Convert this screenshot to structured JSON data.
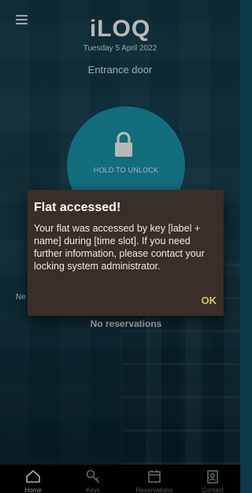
{
  "header": {
    "logo": "iLOQ",
    "date": "Tuesday 5 April 2022",
    "door_name": "Entrance door"
  },
  "unlock": {
    "label": "HOLD TO UNLOCK"
  },
  "reservations": {
    "next_label_fragment": "Ne",
    "empty_text": "No reservations"
  },
  "dialog": {
    "title": "Flat accessed!",
    "body": "Your flat was accessed by key [label + name] during [time slot]. If you need further information, please contact your locking system administrator.",
    "ok_label": "OK"
  },
  "bottom_nav": {
    "items": [
      {
        "label": "Home",
        "icon": "home-icon",
        "active": true
      },
      {
        "label": "Keys",
        "icon": "key-icon",
        "active": false
      },
      {
        "label": "Reservations",
        "icon": "calendar-icon",
        "active": false
      },
      {
        "label": "Contact",
        "icon": "contact-card-icon",
        "active": false
      }
    ]
  },
  "colors": {
    "accent_circle": "#1a98ad",
    "dialog_bg": "#3a2e29",
    "ok_button": "#d9cb49"
  }
}
